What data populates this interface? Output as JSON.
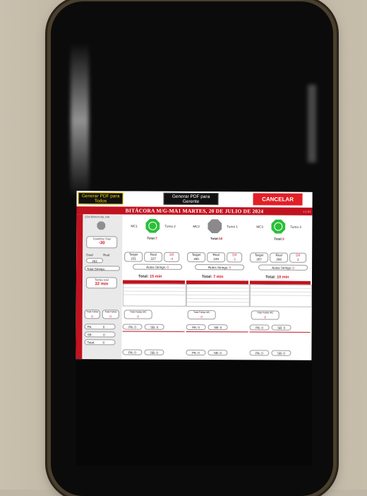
{
  "topbar": {
    "pdf_todos": "Generar PDF para Todos",
    "pdf_gerente": "Generar PDF para Gerente",
    "cancel": "CANCELAR"
  },
  "title": "BITÁCORA   M/G-MA1   MARTES, 20 DE JULIO DE 2024",
  "version": "v.1.01",
  "left": {
    "section_label": "EFICIENCIA DEL DÍA",
    "downtime_label": "Downtime Total",
    "downtime_value": "-30",
    "goal_label": "Goal",
    "real_label": "Real",
    "goal_value": "262",
    "total_strings_label": "Total Strings:",
    "tiempo_label": "Tiempo total",
    "tiempo_value": "32 min",
    "fallas_label": "Total Fallas",
    "fallas_value": "0",
    "fallas2_label": "Total Fallas",
    "fallas2_value": "0",
    "pa_label": "PA:",
    "pa_value": "0",
    "sb_label": "SB:",
    "sb_value": "0",
    "total_label": "Total:",
    "total_value": "0"
  },
  "shifts": [
    {
      "mc": "MC1",
      "turno": "Turno 2",
      "total_label": "Total:",
      "total_value": "7",
      "target_label": "Target",
      "target": "231",
      "real_label": "Real",
      "real": "227",
      "dif_label": "Dif",
      "dif": "-4",
      "strings_label": "Autos Strings:",
      "strings": "0",
      "tiempo_label": "Total:",
      "tiempo": "15 min",
      "fallas_label": "Total Fallas MC",
      "fallas": "0",
      "pa": "0",
      "sb": "0"
    },
    {
      "mc": "MC2",
      "turno": "Turno 1",
      "total_label": "Total:",
      "total_value": "10",
      "target_label": "Target",
      "target": "250",
      "real_label": "Real",
      "real": "249",
      "dif_label": "Dif",
      "dif": "-1",
      "strings_label": "Rutes Strings:",
      "strings": "0",
      "tiempo_label": "Total:",
      "tiempo": "7 min",
      "fallas_label": "Total Fallas MC",
      "fallas": "0",
      "pa": "0",
      "sb": "0"
    },
    {
      "mc": "MC3",
      "turno": "Turno 3",
      "total_label": "Total:",
      "total_value": "3",
      "target_label": "Target",
      "target": "267",
      "real_label": "Real",
      "real": "268",
      "dif_label": "Dif",
      "dif": "1",
      "strings_label": "Autos Strings:",
      "strings": "0",
      "tiempo_label": "Total:",
      "tiempo": "10 min",
      "fallas_label": "Total Fallas MC",
      "fallas": "0",
      "pa": "0",
      "sb": "0"
    }
  ],
  "colors": {
    "red": "#c1121f",
    "green": "#2bbf3a",
    "yellow": "#f2d100"
  }
}
